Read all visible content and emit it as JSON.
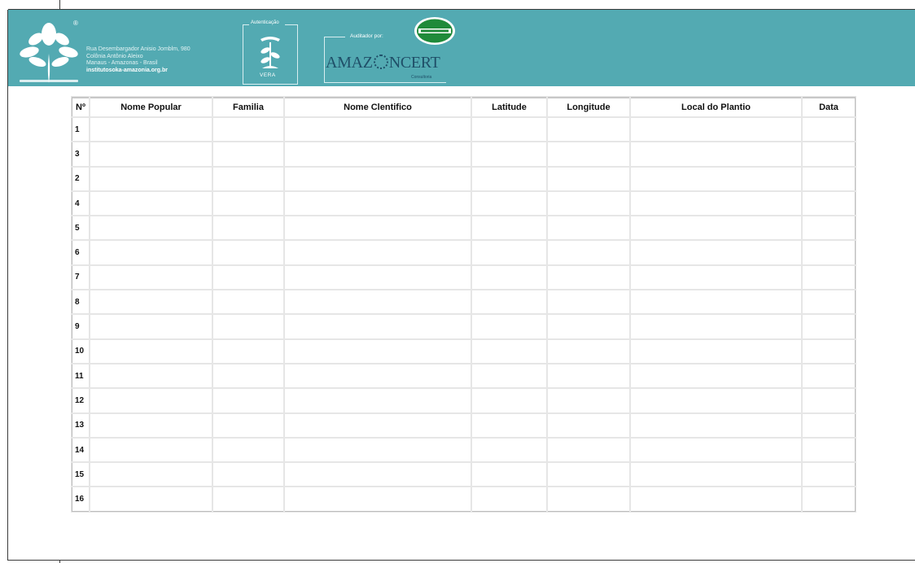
{
  "header": {
    "address_lines": [
      "Rua Desembargador Anisio Jomblm, 980",
      "Colônia Antônio Aleixo",
      "Manaus - Amazonas - Brasil"
    ],
    "website": "institutosoka-amazonia.org.br",
    "registered_mark": "®",
    "authentication_label": "Autenticação",
    "vera_label": "VERA",
    "audited_by_label": "Auditador por:",
    "certifier_prefix": "AMAZ",
    "certifier_suffix": "NCERT",
    "certifier_sub": "Consultoria"
  },
  "colors": {
    "header_band": "#53aab2",
    "border": "#bcbcbc",
    "seal_green": "#1f8a3a"
  },
  "table": {
    "columns": [
      "Nº",
      "Nome Popular",
      "Familia",
      "Nome Clentifico",
      "Latitude",
      "Longitude",
      "Local do Plantio",
      "Data"
    ],
    "row_numbers": [
      "1",
      "3",
      "2",
      "4",
      "5",
      "6",
      "7",
      "8",
      "9",
      "10",
      "11",
      "12",
      "13",
      "14",
      "15",
      "16"
    ]
  }
}
